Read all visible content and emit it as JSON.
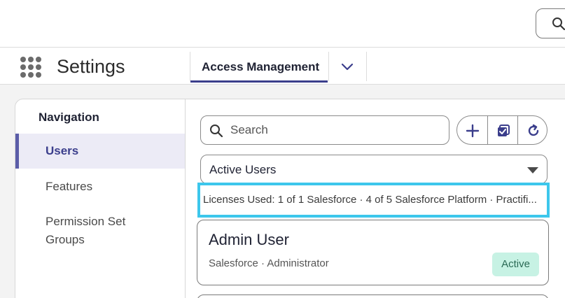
{
  "app": {
    "title": "Settings",
    "tabs": [
      {
        "label": "Access Management",
        "active": true
      }
    ]
  },
  "nav": {
    "heading": "Navigation",
    "items": [
      {
        "label": "Users",
        "active": true
      },
      {
        "label": "Features",
        "active": false
      },
      {
        "label": "Permission Set Groups",
        "active": false
      }
    ]
  },
  "list": {
    "search_placeholder": "Search",
    "view": "Active Users",
    "licenses": "Licenses Used: 1 of 1 Salesforce · 4 of 5 Salesforce Platform · Practifi...",
    "users": [
      {
        "name": "Admin User",
        "meta": "Salesforce · Administrator",
        "status": "Active"
      }
    ]
  },
  "icons": {
    "app_launcher": "waffle-icon",
    "global_search": "search-icon",
    "tab_more": "chevron-down-icon",
    "add": "plus-icon",
    "select": "checkbox-icon",
    "refresh": "refresh-icon"
  },
  "colors": {
    "accent": "#3b3e8c",
    "nav_active_bg": "#ecebf6",
    "highlight_border": "#3dc7ec",
    "badge_bg": "#c7f2e4"
  }
}
